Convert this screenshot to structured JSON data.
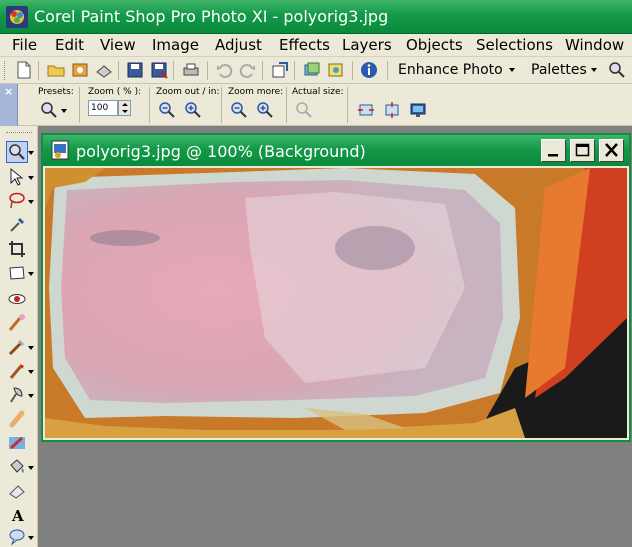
{
  "app": {
    "title": "Corel Paint Shop Pro Photo XI - polyorig3.jpg"
  },
  "menu": {
    "items": [
      "File",
      "Edit",
      "View",
      "Image",
      "Adjust",
      "Effects",
      "Layers",
      "Objects",
      "Selections",
      "Window"
    ]
  },
  "toolbar": {
    "enhance_photo_label": "Enhance Photo",
    "palettes_label": "Palettes"
  },
  "tool_options": {
    "presets_label": "Presets:",
    "zoom_label": "Zoom ( % ):",
    "zoom_value": "100",
    "zoom_out_in_label": "Zoom out / in:",
    "zoom_more_label": "Zoom more:",
    "actual_size_label": "Actual size:"
  },
  "document": {
    "title": "polyorig3.jpg @ 100% (Background)"
  },
  "colors": {
    "title_green": "#139a48",
    "chrome": "#ece9d8",
    "workspace": "#808080",
    "selection": "#316ac5"
  }
}
